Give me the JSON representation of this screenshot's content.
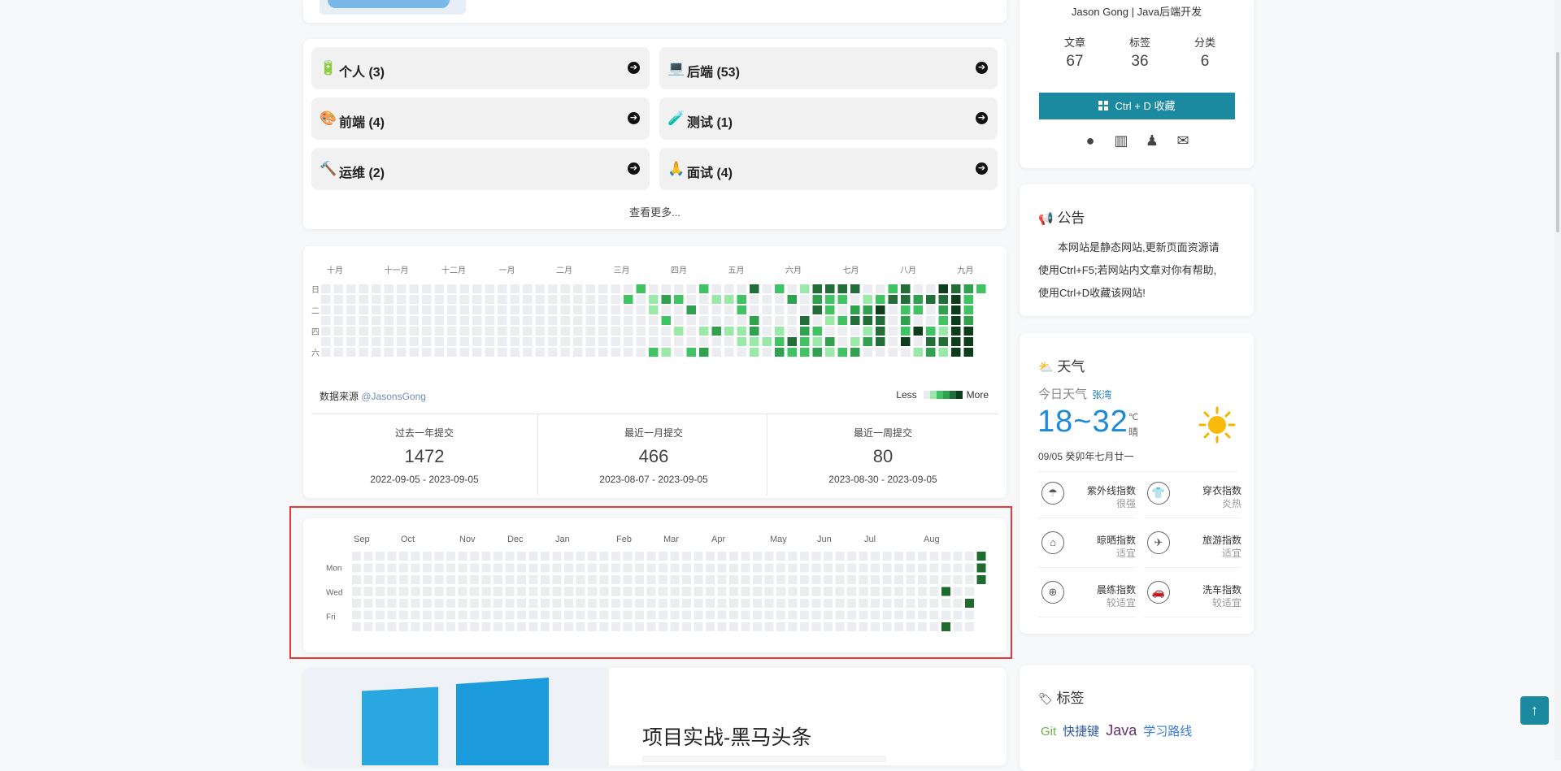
{
  "categories": {
    "items": [
      {
        "icon": "🔋",
        "label": "个人 (3)"
      },
      {
        "icon": "💻",
        "label": "后端 (53)"
      },
      {
        "icon": "🎨",
        "label": "前端 (4)"
      },
      {
        "icon": "🧪",
        "label": "测试 (1)"
      },
      {
        "icon": "🔨",
        "label": "运维 (2)"
      },
      {
        "icon": "🙏",
        "label": "面试 (4)"
      }
    ],
    "more_label": "查看更多..."
  },
  "contrib_cn": {
    "months": [
      "十月",
      "十一月",
      "十二月",
      "一月",
      "二月",
      "三月",
      "四月",
      "五月",
      "六月",
      "七月",
      "八月",
      "九月"
    ],
    "weekdays": [
      "日",
      "二",
      "四",
      "六"
    ],
    "source_label": "数据来源",
    "source_user": "@JasonsGong",
    "less_label": "Less",
    "more_label": "More",
    "stats": [
      {
        "title": "过去一年提交",
        "value": "1472",
        "range": "2022-09-05 - 2023-09-05"
      },
      {
        "title": "最近一月提交",
        "value": "466",
        "range": "2023-08-07 - 2023-09-05"
      },
      {
        "title": "最近一周提交",
        "value": "80",
        "range": "2023-08-30 - 2023-09-05"
      }
    ],
    "colors": [
      "#ebedf0",
      "#9be9a8",
      "#40c463",
      "#30a14e",
      "#216e39",
      "#0e3d1c"
    ]
  },
  "contrib_en": {
    "months": [
      "Sep",
      "Oct",
      "Nov",
      "Dec",
      "Jan",
      "Feb",
      "Mar",
      "Apr",
      "May",
      "Jun",
      "Jul",
      "Aug"
    ],
    "weekdays": [
      "Mon",
      "Wed",
      "Fri"
    ]
  },
  "post": {
    "title": "项目实战-黑马头条"
  },
  "profile": {
    "bio": "Jason Gong | Java后端开发",
    "stats": [
      {
        "label": "文章",
        "value": "67"
      },
      {
        "label": "标签",
        "value": "36"
      },
      {
        "label": "分类",
        "value": "6"
      }
    ],
    "bookmark_label": "Ctrl + D 收藏",
    "accent_color": "#1b8aa1"
  },
  "announcement": {
    "title": "公告",
    "lines": [
      "本网站是静态网站,更新页面资源请",
      "使用Ctrl+F5;若网站内文章对你有帮助,",
      "使用Ctrl+D收藏该网站!"
    ]
  },
  "weather": {
    "title": "天气",
    "today_label": "今日天气",
    "city": "张湾",
    "temp": "18~32",
    "unit": "℃",
    "desc": "晴",
    "date": "09/05 癸卯年七月廿一",
    "indices": [
      {
        "icon": "umbrella-icon",
        "glyph": "☂",
        "name": "紫外线指数",
        "value": "很强"
      },
      {
        "icon": "shirt-icon",
        "glyph": "👕",
        "name": "穿衣指数",
        "value": "炎热"
      },
      {
        "icon": "hanger-icon",
        "glyph": "⌂",
        "name": "晾晒指数",
        "value": "适宜"
      },
      {
        "icon": "plane-icon",
        "glyph": "✈",
        "name": "旅游指数",
        "value": "适宜"
      },
      {
        "icon": "basketball-icon",
        "glyph": "⊕",
        "name": "晨练指数",
        "value": "较适宜"
      },
      {
        "icon": "car-icon",
        "glyph": "🚗",
        "name": "洗车指数",
        "value": "较适宜"
      }
    ]
  },
  "tags": {
    "title": "标签",
    "items": [
      {
        "label": "Git",
        "color": "#6ab04c"
      },
      {
        "label": "快捷键",
        "color": "#2c5aa0"
      },
      {
        "label": "Java",
        "color": "#6a2c70"
      },
      {
        "label": "学习路线",
        "color": "#3a7bd5"
      }
    ]
  }
}
